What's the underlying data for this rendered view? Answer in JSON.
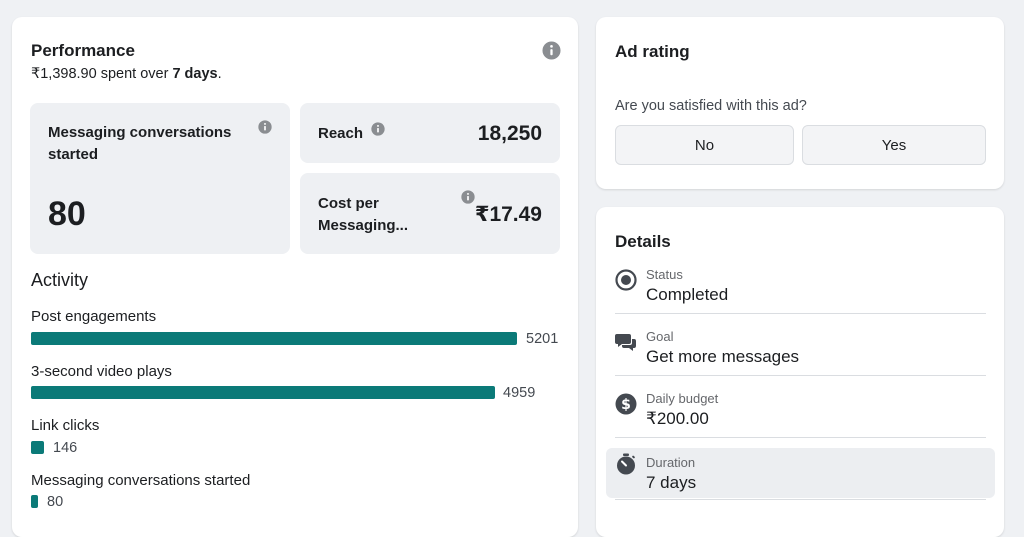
{
  "performance": {
    "title": "Performance",
    "amount": "₹1,398.90",
    "spent_over": " spent over ",
    "days": "7 days",
    "period_end": ".",
    "metrics": {
      "messaging": {
        "label": "Messaging conversations started",
        "value": "80"
      },
      "reach": {
        "label": "Reach",
        "value": "18,250"
      },
      "cost": {
        "label": "Cost per Messaging...",
        "value": "₹17.49"
      }
    }
  },
  "activity": {
    "title": "Activity",
    "items": [
      {
        "label": "Post engagements",
        "value": "5201"
      },
      {
        "label": "3-second video plays",
        "value": "4959"
      },
      {
        "label": "Link clicks",
        "value": "146"
      },
      {
        "label": "Messaging conversations started",
        "value": "80"
      }
    ]
  },
  "ad_rating": {
    "title": "Ad rating",
    "question": "Are you satisfied with this ad?",
    "no_label": "No",
    "yes_label": "Yes"
  },
  "details": {
    "title": "Details",
    "rows": [
      {
        "label": "Status",
        "value": "Completed",
        "icon": "status-icon"
      },
      {
        "label": "Goal",
        "value": "Get more messages",
        "icon": "chat-bubbles-icon"
      },
      {
        "label": "Daily budget",
        "value": "₹200.00",
        "icon": "dollar-icon"
      },
      {
        "label": "Duration",
        "value": "7 days",
        "icon": "stopwatch-icon"
      }
    ]
  },
  "colors": {
    "bar": "#0b7a78",
    "icon": "#444950"
  }
}
